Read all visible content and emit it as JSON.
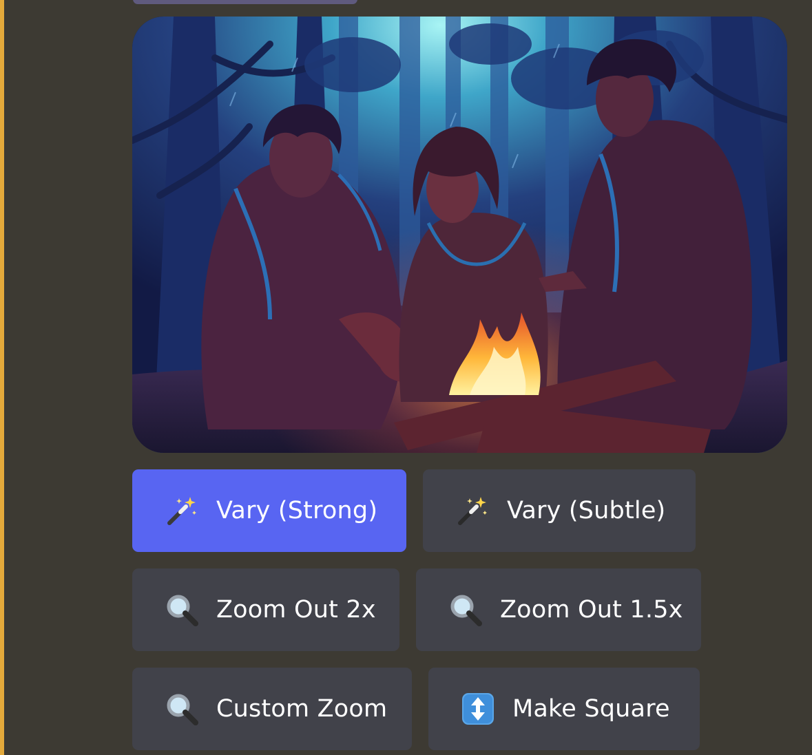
{
  "colors": {
    "page_background": "#3d3a33",
    "left_accent": "#e3a93b",
    "primary_button": "#5865f2",
    "secondary_button": "#41424a",
    "button_text": "#ffffff"
  },
  "image": {
    "description_icon": "campfire-forest-illustration"
  },
  "buttons": {
    "vary_strong": {
      "label": "Vary (Strong)",
      "icon": "magic-wand-icon"
    },
    "vary_subtle": {
      "label": "Vary (Subtle)",
      "icon": "magic-wand-icon"
    },
    "zoom_out_2x": {
      "label": "Zoom Out 2x",
      "icon": "magnifier-icon"
    },
    "zoom_out_1_5x": {
      "label": "Zoom Out 1.5x",
      "icon": "magnifier-icon"
    },
    "custom_zoom": {
      "label": "Custom Zoom",
      "icon": "magnifier-icon"
    },
    "make_square": {
      "label": "Make Square",
      "icon": "up-down-arrow-icon"
    }
  }
}
